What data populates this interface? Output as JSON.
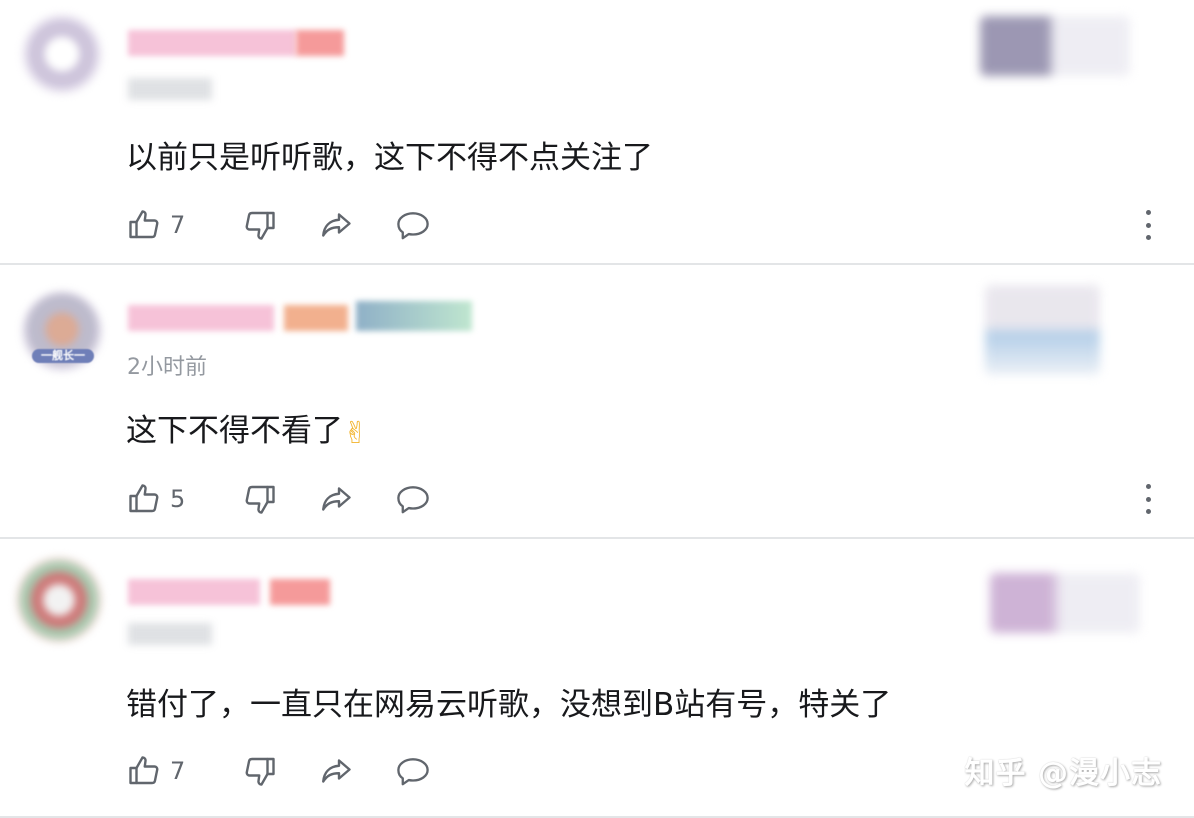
{
  "comments": [
    {
      "time": "",
      "text": "以前只是听听歌，这下不得不点关注了",
      "likes": "7"
    },
    {
      "time": "2小时前",
      "badge": "一舰长一",
      "text": "这下不得不看了",
      "emoji": "✌",
      "likes": "5"
    },
    {
      "time": "",
      "text": "错付了，一直只在网易云听歌，没想到B站有号，特关了",
      "likes": "7"
    }
  ],
  "icons": {
    "like": "thumbs-up-icon",
    "dislike": "thumbs-down-icon",
    "share": "share-arrow-icon",
    "reply": "comment-bubble-icon",
    "more": "more-vertical-icon"
  },
  "watermark": "知乎 @漫小志",
  "colors": {
    "text": "#18191c",
    "muted": "#9499a0",
    "icon": "#61666d",
    "divider": "#e3e5e7"
  }
}
